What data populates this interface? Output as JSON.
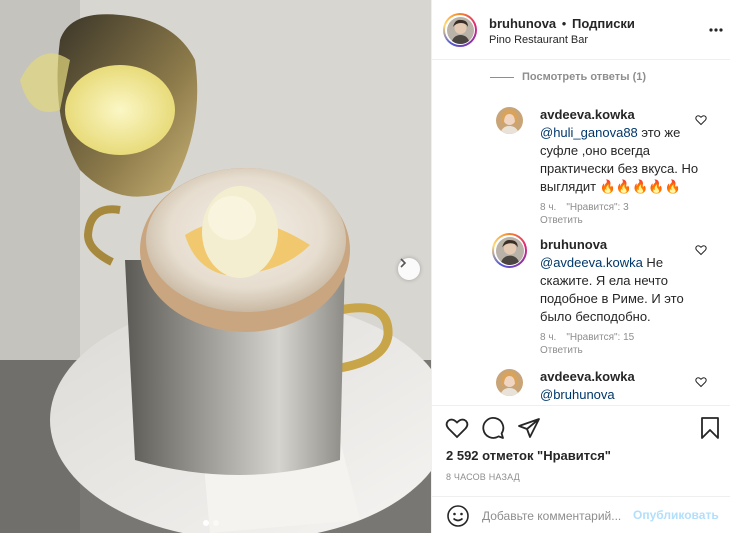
{
  "header": {
    "username": "bruhunova",
    "separator": "•",
    "follow_label": "Подписки",
    "location": "Pino Restaurant Bar",
    "more_icon": "more-horizontal-icon"
  },
  "comments": {
    "view_replies_label": "Посмотреть ответы (1)",
    "items": [
      {
        "username": "avdeeva.kowka",
        "mention": "@huli_ganova88",
        "text": " это же суфле ,оно всегда практически без вкуса. Но выглядит 🔥🔥🔥🔥🔥",
        "time": "8 ч.",
        "likes": "\"Нравится\": 3",
        "reply_label": "Ответить"
      },
      {
        "username": "bruhunova",
        "mention": "@avdeeva.kowka",
        "text": " Не скажите. Я ела нечто подобное в Риме. И это было бесподобно.",
        "time": "8 ч.",
        "likes": "\"Нравится\": 15",
        "reply_label": "Ответить"
      },
      {
        "username": "avdeeva.kowka",
        "mention": "@bruhunova",
        "text": ""
      }
    ]
  },
  "actions": {
    "like_icon": "heart-icon",
    "comment_icon": "comment-icon",
    "share_icon": "share-icon",
    "save_icon": "bookmark-icon",
    "likes_text": "2 592 отметок \"Нравится\"",
    "time_ago": "8 ЧАСОВ НАЗАД"
  },
  "add_comment": {
    "placeholder": "Добавьте комментарий...",
    "publish_label": "Опубликовать"
  },
  "carousel": {
    "current": 1,
    "total": 2
  },
  "colors": {
    "text": "#262626",
    "secondary": "#8e8e8e",
    "mention": "#00376b",
    "publish_disabled": "#b2dffc"
  }
}
